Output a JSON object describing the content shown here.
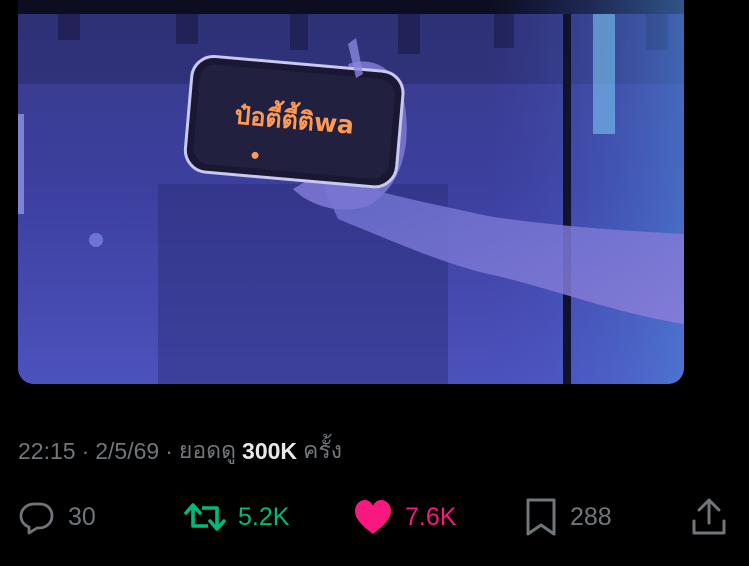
{
  "media": {
    "sign_text": "ป๋อตี้ตี้ติwa"
  },
  "meta": {
    "time": "22:15",
    "separator": "·",
    "date": "2/5/69",
    "views_label": "ยอดดู",
    "views_count": "300K",
    "views_suffix": "ครั้ง"
  },
  "actions": {
    "reply_count": "30",
    "repost_count": "5.2K",
    "like_count": "7.6K",
    "bookmark_count": "288"
  },
  "colors": {
    "background": "#000000",
    "secondary_text": "#71767b",
    "primary_text": "#e7e9ea",
    "repost_active": "#00ba7c",
    "like_active": "#f91880"
  },
  "icons": [
    "reply-icon",
    "repost-icon",
    "heart-icon",
    "bookmark-icon",
    "share-icon"
  ]
}
